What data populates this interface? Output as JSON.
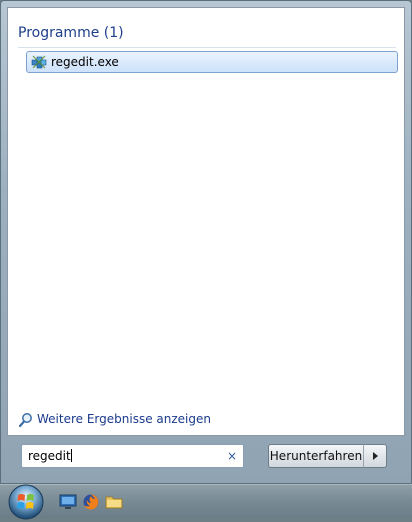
{
  "results": {
    "group_header": "Programme (1)",
    "items": [
      {
        "label": "regedit.exe",
        "icon": "registry-editor-icon"
      }
    ]
  },
  "more_results_label": "Weitere Ergebnisse anzeigen",
  "search": {
    "value": "regedit",
    "clear_glyph": "×"
  },
  "shutdown": {
    "label": "Herunterfahren",
    "arrow": "options-arrow-icon"
  },
  "taskbar": {
    "pinned": [
      "desktop-icon",
      "firefox-icon",
      "explorer-folder-icon"
    ]
  },
  "colors": {
    "link": "#1a3a8c",
    "highlight_border": "#7da2ce",
    "header": "#1e3f8a"
  }
}
